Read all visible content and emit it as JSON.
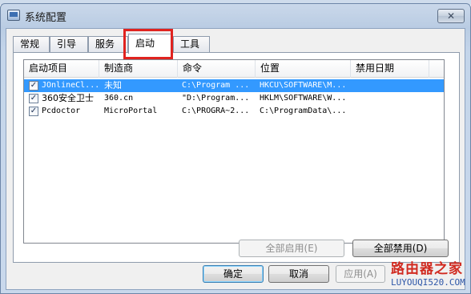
{
  "window": {
    "title": "系统配置",
    "close_glyph": "✕"
  },
  "tabs": [
    {
      "label": "常规"
    },
    {
      "label": "引导"
    },
    {
      "label": "服务"
    },
    {
      "label": "启动",
      "active": true
    },
    {
      "label": "工具"
    }
  ],
  "listview": {
    "columns": [
      "启动项目",
      "制造商",
      "命令",
      "位置",
      "禁用日期"
    ],
    "rows": [
      {
        "checked": true,
        "selected": true,
        "item": "JOnlineCl...",
        "maker": "未知",
        "command": "C:\\Program ...",
        "location": "HKCU\\SOFTWARE\\M...",
        "date": ""
      },
      {
        "checked": true,
        "selected": false,
        "item": "360安全卫士",
        "maker": "360.cn",
        "command": "\"D:\\Program...",
        "location": "HKLM\\SOFTWARE\\W...",
        "date": ""
      },
      {
        "checked": true,
        "selected": false,
        "item": "Pcdoctor",
        "maker": "MicroPortal",
        "command": "C:\\PROGRA~2...",
        "location": "C:\\ProgramData\\...",
        "date": ""
      }
    ]
  },
  "buttons": {
    "enable_all": "全部启用(E)",
    "disable_all": "全部禁用(D)",
    "ok": "确定",
    "cancel": "取消",
    "apply": "应用(A)"
  },
  "watermark": {
    "title": "路由器之家",
    "url": "LUYOUQI520.COM"
  },
  "colors": {
    "selection": "#3399ff",
    "highlight_box": "#e0231f",
    "watermark_red": "#d12b21",
    "watermark_blue": "#2d56a8"
  }
}
